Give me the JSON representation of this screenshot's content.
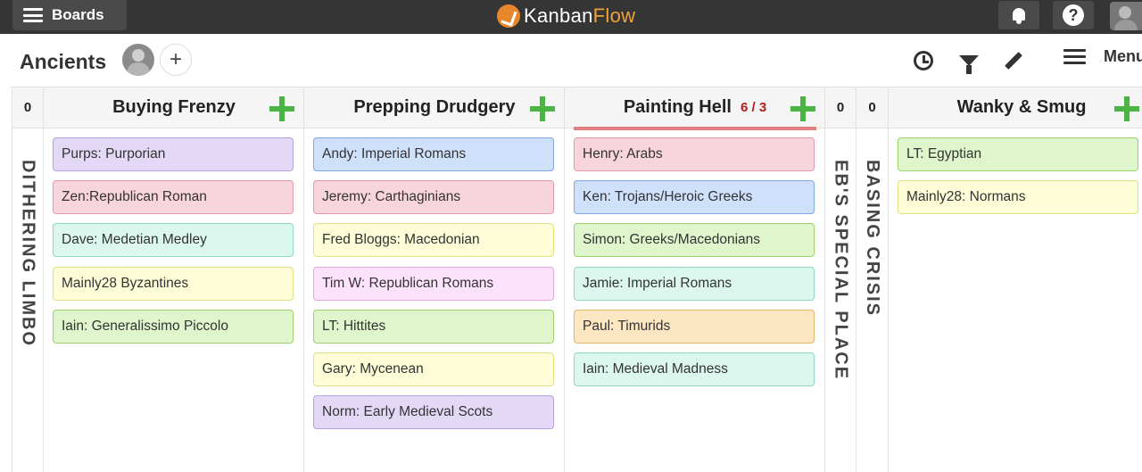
{
  "topbar": {
    "boards_label": "Boards",
    "logo_kanban": "Kanban",
    "logo_flow": "Flow",
    "help_glyph": "?"
  },
  "board": {
    "title": "Ancients",
    "add_member_glyph": "+",
    "menu_label": "Menu"
  },
  "columns": [
    {
      "type": "collapsed",
      "count": "0",
      "label": "DITHERING LIMBO"
    },
    {
      "type": "expanded",
      "title": "Buying Frenzy",
      "tasks": [
        {
          "text": "Purps: Purporian",
          "color": "purple"
        },
        {
          "text": "Zen:Republican Roman",
          "color": "red"
        },
        {
          "text": "Dave: Medetian Medley",
          "color": "teal"
        },
        {
          "text": "Mainly28 Byzantines",
          "color": "yellow"
        },
        {
          "text": "Iain: Generalissimo Piccolo",
          "color": "green"
        }
      ]
    },
    {
      "type": "expanded",
      "title": "Prepping Drudgery",
      "tasks": [
        {
          "text": "Andy: Imperial Romans",
          "color": "blue"
        },
        {
          "text": "Jeremy: Carthaginians",
          "color": "red"
        },
        {
          "text": "Fred Bloggs: Macedonian",
          "color": "yellow"
        },
        {
          "text": "Tim W: Republican Romans",
          "color": "pink"
        },
        {
          "text": "LT: Hittites",
          "color": "green"
        },
        {
          "text": "Gary: Mycenean",
          "color": "yellow"
        },
        {
          "text": "Norm: Early Medieval Scots",
          "color": "purple"
        }
      ]
    },
    {
      "type": "expanded",
      "title": "Painting Hell",
      "wip": "6 / 3",
      "tasks": [
        {
          "text": "Henry: Arabs",
          "color": "red"
        },
        {
          "text": "Ken: Trojans/Heroic Greeks",
          "color": "blue"
        },
        {
          "text": "Simon: Greeks/Macedonians",
          "color": "green"
        },
        {
          "text": "Jamie: Imperial Romans",
          "color": "teal"
        },
        {
          "text": "Paul: Timurids",
          "color": "orange"
        },
        {
          "text": "Iain: Medieval Madness",
          "color": "teal"
        }
      ]
    },
    {
      "type": "collapsed",
      "count": "0",
      "label": "EB'S SPECIAL PLACE"
    },
    {
      "type": "collapsed",
      "count": "0",
      "label": "BASING CRISIS"
    },
    {
      "type": "expanded",
      "title": "Wanky & Smug",
      "tasks": [
        {
          "text": "LT: Egyptian",
          "color": "green"
        },
        {
          "text": "Mainly28: Normans",
          "color": "yellow"
        }
      ]
    }
  ],
  "colors": {
    "purple": "#e3d8f5",
    "red": "#f8d4dc",
    "teal": "#dcf7ee",
    "yellow": "#fdfdd8",
    "green": "#dff5cc",
    "blue": "#cfe0fa",
    "pink": "#fce3fb",
    "orange": "#fde6c2",
    "add_green": "#4bb543",
    "wip_red": "#b21e1e",
    "topbar": "#353535"
  }
}
